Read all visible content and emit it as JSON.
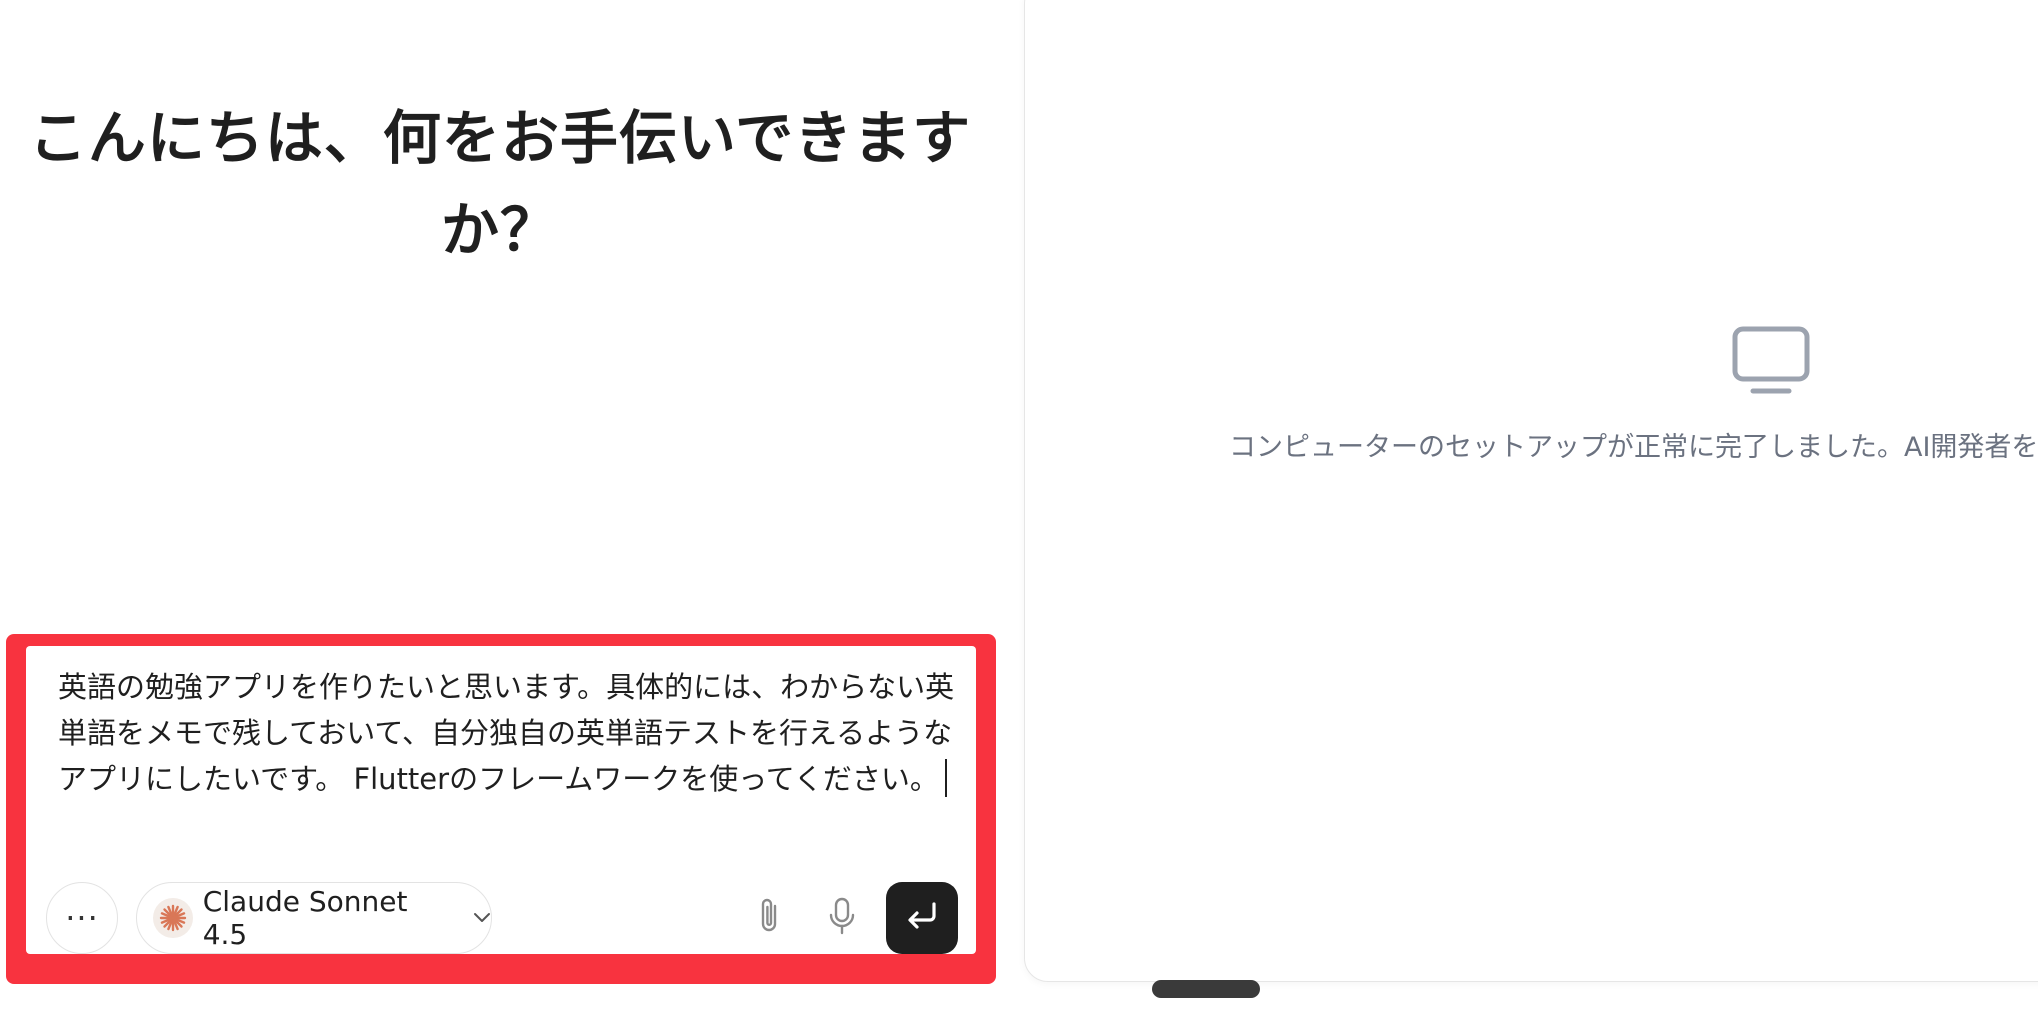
{
  "chat": {
    "greeting_line1": "こんにちは、何をお手伝いできます",
    "greeting_line2": "か？",
    "composer": {
      "text": "英語の勉強アプリを作りたいと思います。具体的には、わからない英単語をメモで残しておいて、自分独自の英単語テストを行えるようなアプリにしたいです。 Flutterのフレームワークを使ってください。",
      "more_label": "···",
      "model_label": "Claude Sonnet 4.5",
      "icons": {
        "more": "ellipsis-icon",
        "model": "claude-logo-icon",
        "dropdown": "chevron-down-icon",
        "attach": "paperclip-icon",
        "mic": "microphone-icon",
        "send": "enter-icon"
      }
    },
    "colors": {
      "highlight": "#f8333f",
      "send_button": "#1f1f1f"
    }
  },
  "computer_panel": {
    "icon": "monitor-icon",
    "status_text": "コンピューターのセットアップが正常に完了しました。AI開発者を"
  }
}
